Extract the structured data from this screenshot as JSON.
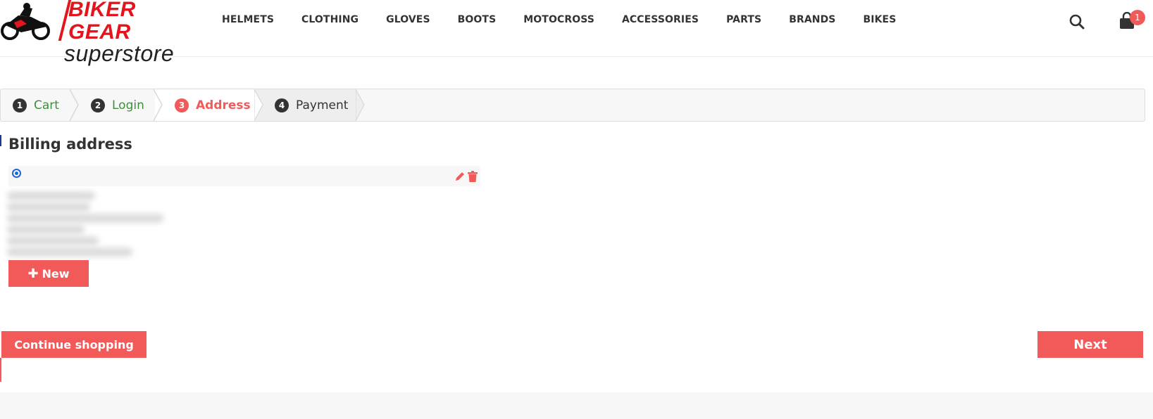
{
  "brand": {
    "line1": "BIKER GEAR",
    "line2": "superstore",
    "accent_color": "#e3141c"
  },
  "nav": {
    "items": [
      "HELMETS",
      "CLOTHING",
      "GLOVES",
      "BOOTS",
      "MOTOCROSS",
      "ACCESSORIES",
      "PARTS",
      "BRANDS",
      "BIKES"
    ]
  },
  "header_icons": {
    "search": "search-icon",
    "cart": "shopping-bag-icon",
    "cart_count": "1"
  },
  "checkout_steps": [
    {
      "num": "1",
      "label": "Cart",
      "state": "done"
    },
    {
      "num": "2",
      "label": "Login",
      "state": "done"
    },
    {
      "num": "3",
      "label": "Address",
      "state": "active"
    },
    {
      "num": "4",
      "label": "Payment",
      "state": "next"
    }
  ],
  "billing": {
    "title": "Billing address",
    "selected": true,
    "edit_icon": "pencil-icon",
    "delete_icon": "trash-icon",
    "new_label": "New"
  },
  "actions": {
    "continue_label": "Continue shopping",
    "next_label": "Next"
  },
  "colors": {
    "primary": "#f25a5a",
    "done_step": "#3e8e3e",
    "radio": "#1a66d9"
  }
}
